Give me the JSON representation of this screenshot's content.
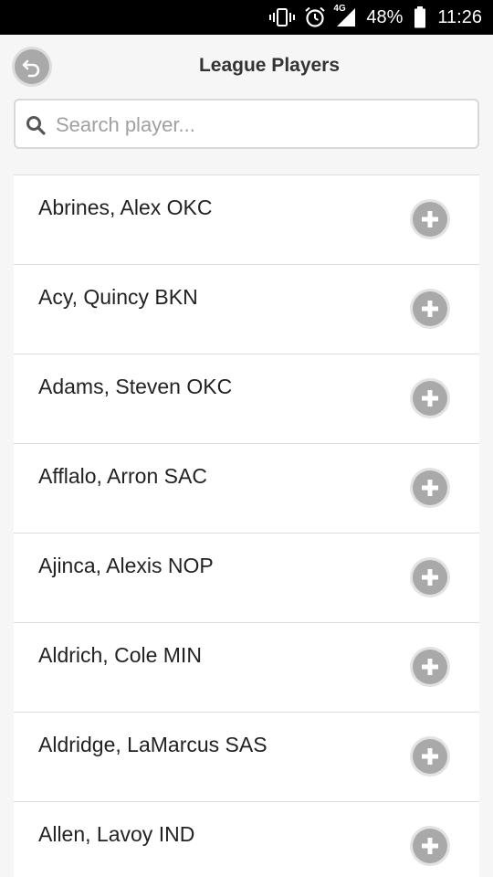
{
  "status_bar": {
    "battery_text": "48%",
    "time": "11:26",
    "network_label": "4G",
    "icons": [
      "vibrate-icon",
      "alarm-icon",
      "signal-icon",
      "battery-icon"
    ]
  },
  "header": {
    "title": "League Players",
    "back_icon": "undo-arrow-icon"
  },
  "search": {
    "placeholder": "Search player...",
    "value": ""
  },
  "players": [
    {
      "label": "Abrines, Alex OKC"
    },
    {
      "label": "Acy, Quincy BKN"
    },
    {
      "label": "Adams, Steven OKC"
    },
    {
      "label": "Afflalo, Arron SAC"
    },
    {
      "label": "Ajinca, Alexis NOP"
    },
    {
      "label": "Aldrich, Cole MIN"
    },
    {
      "label": "Aldridge, LaMarcus SAS"
    },
    {
      "label": "Allen, Lavoy IND"
    }
  ],
  "colors": {
    "button_gray": "#a9a9a9",
    "background": "#f6f6f6",
    "status_bar": "#000000"
  }
}
